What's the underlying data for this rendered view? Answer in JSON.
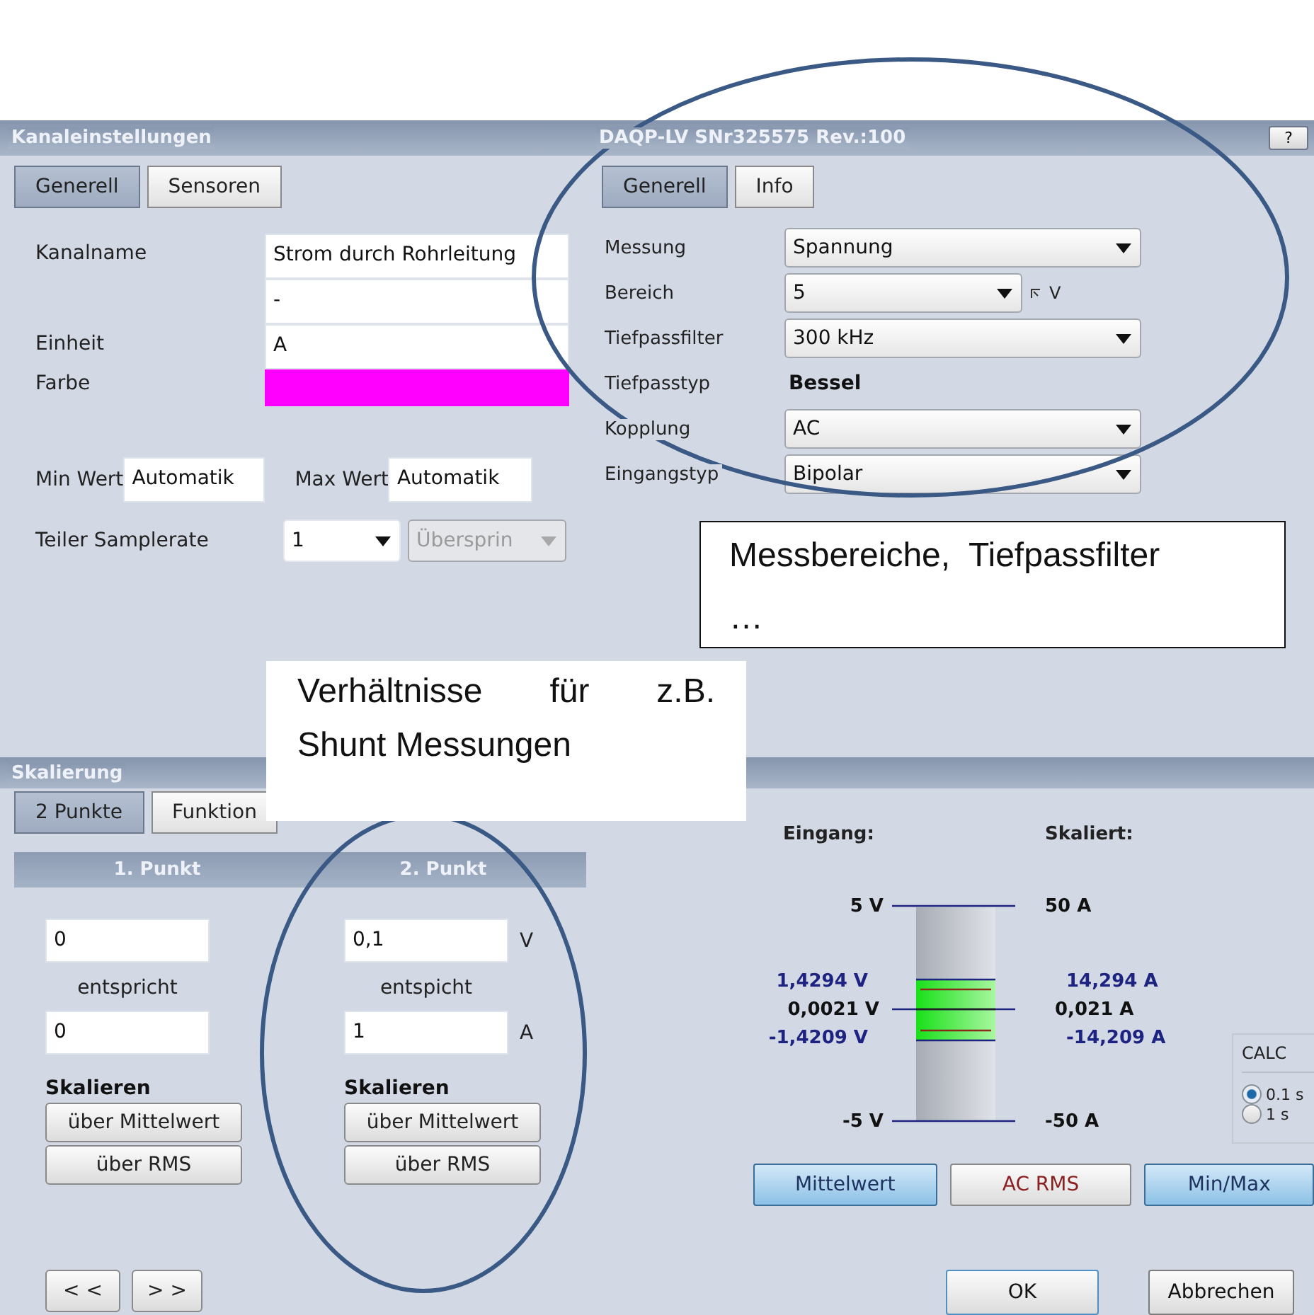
{
  "channel_panel": {
    "title": "Kanaleinstellungen",
    "tabs": [
      {
        "label": "Generell",
        "selected": true
      },
      {
        "label": "Sensoren",
        "selected": false
      }
    ],
    "name_label": "Kanalname",
    "name_value": "Strom durch Rohrleitung",
    "second_value": "-",
    "unit_label": "Einheit",
    "unit_value": "A",
    "color_label": "Farbe",
    "color": "#ff00ff",
    "min_label": "Min Wert",
    "min_value": "Automatik",
    "max_label": "Max Wert",
    "max_value": "Automatik",
    "divider_label": "Teiler Samplerate",
    "divider_value": "1",
    "skip_select": {
      "value": "Übersprin",
      "disabled": true
    }
  },
  "device_panel": {
    "title": "DAQP-LV  SNr325575 Rev.:100",
    "help": "?",
    "tabs": [
      {
        "label": "Generell",
        "selected": true
      },
      {
        "label": "Info",
        "selected": false
      }
    ],
    "rows": [
      {
        "kind": "select",
        "label": "Messung",
        "value": "Spannung"
      },
      {
        "kind": "select",
        "label": "Bereich",
        "value": "5",
        "unit": "V"
      },
      {
        "kind": "select",
        "label": "Tiefpassfilter",
        "value": "300 kHz"
      },
      {
        "kind": "text",
        "label": "Tiefpasstyp",
        "value": "Bessel"
      },
      {
        "kind": "select",
        "label": "Kopplung",
        "value": "AC"
      },
      {
        "kind": "select",
        "label": "Eingangstyp",
        "value": "Bipolar"
      }
    ]
  },
  "scaling": {
    "title": "Skalierung",
    "tabs": [
      {
        "label": "2 Punkte",
        "selected": true
      },
      {
        "label": "Funktion",
        "selected": false
      }
    ],
    "points": [
      {
        "heading": "1. Punkt",
        "input_value": "0",
        "relation": "entspricht",
        "output_value": "0",
        "scale_label": "Skalieren",
        "buttons": [
          "über Mittelwert",
          "über RMS"
        ]
      },
      {
        "heading": "2. Punkt",
        "input_value": "0,1",
        "input_unit": "V",
        "relation": "entspicht",
        "output_value": "1",
        "output_unit": "A",
        "scale_label": "Skalieren",
        "buttons": [
          "über Mittelwert",
          "über RMS"
        ]
      }
    ],
    "nav_buttons": [
      "< <",
      "> >"
    ],
    "input_heading": "Eingang:",
    "scaled_heading": "Skaliert:",
    "gauge": {
      "input_labels": [
        {
          "text": "5 V",
          "kind": "limit"
        },
        {
          "text": "1,4294 V",
          "kind": "peak"
        },
        {
          "text": "0,0021 V",
          "kind": "mean"
        },
        {
          "text": "-1,4209 V",
          "kind": "peak"
        },
        {
          "text": "-5 V",
          "kind": "limit"
        }
      ],
      "scaled_labels": [
        {
          "text": "50 A",
          "kind": "limit"
        },
        {
          "text": "14,294 A",
          "kind": "peak"
        },
        {
          "text": "0,021 A",
          "kind": "mean"
        },
        {
          "text": "-14,209 A",
          "kind": "peak"
        },
        {
          "text": "-50 A",
          "kind": "limit"
        }
      ]
    },
    "calc": {
      "title": "CALC",
      "options": [
        {
          "label": "0.1 s",
          "selected": true
        },
        {
          "label": "1 s",
          "selected": false
        }
      ]
    },
    "modes": [
      {
        "label": "Mittelwert",
        "selected": true
      },
      {
        "label": "AC RMS",
        "selected": false
      },
      {
        "label": "Min/Max",
        "selected": true
      }
    ],
    "dialog_buttons": [
      {
        "label": "OK",
        "default": true
      },
      {
        "label": "Abbrechen",
        "default": false
      }
    ]
  },
  "callouts": [
    {
      "lines": [
        "Messbereiche,  Tiefpassfilter",
        "…"
      ]
    },
    {
      "lines": [
        "Verhältnisse für z.B.",
        "Shunt Messungen"
      ]
    }
  ]
}
